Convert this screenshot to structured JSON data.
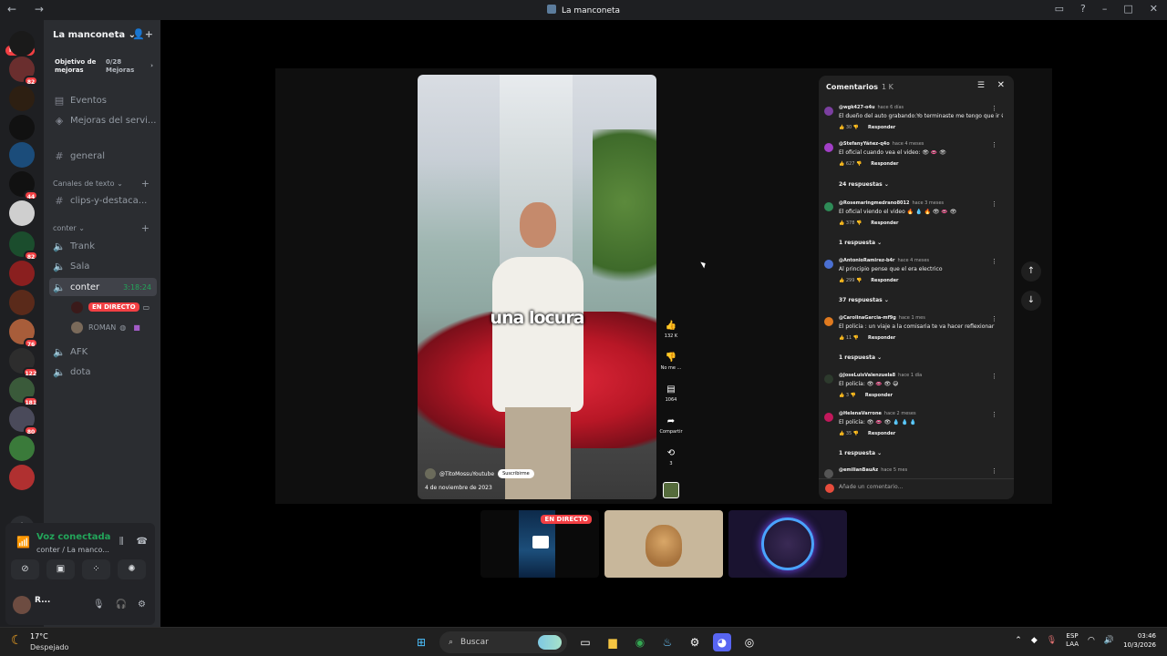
{
  "window": {
    "title": "La manconeta",
    "nav": "← →"
  },
  "titlebar_icons": [
    "inbox-icon",
    "help-icon",
    "minimize-icon",
    "maximize-icon",
    "close-icon"
  ],
  "guilds": {
    "nuevo_badge": "NUEVO",
    "items": [
      {
        "badge": "",
        "color": "#1a1a1a"
      },
      {
        "badge": "82",
        "color": "#6a2e2e"
      },
      {
        "badge": "",
        "color": "#2d1f12"
      },
      {
        "badge": "",
        "color": "#111111"
      },
      {
        "badge": "",
        "color": "#1b4c7a"
      },
      {
        "badge": "44",
        "color": "#111111"
      },
      {
        "badge": "",
        "color": "#cfcfcf"
      },
      {
        "badge": "82",
        "color": "#1b4d2d"
      },
      {
        "badge": "",
        "color": "#8a1f1f"
      },
      {
        "badge": "",
        "color": "#5a2a1a"
      },
      {
        "badge": "76",
        "color": "#a85d3a"
      },
      {
        "badge": "122",
        "color": "#2d2d2d"
      },
      {
        "badge": "181",
        "color": "#3a5a3a"
      },
      {
        "badge": "80",
        "color": "#4a4a5a"
      },
      {
        "badge": "",
        "color": "#3a7a3a"
      },
      {
        "badge": "",
        "color": "#b03030"
      }
    ]
  },
  "server": {
    "name": "La manconeta ⌄",
    "boost_label": "Objetivo de mejoras",
    "boost_count": "0/28 Mejoras",
    "boost_chevron": "›"
  },
  "channels": {
    "eventos": "Eventos",
    "mejoras": "Mejoras del servi...",
    "general": "general",
    "cat_text": "Canales de texto ⌄",
    "clips": "clips-y-destaca...",
    "cat_conter": "conter ⌄",
    "trank": "Trank",
    "sala": "Sala",
    "conter": "conter",
    "conter_time": "3:18:24",
    "live_label": "EN DIRECTO",
    "user_roman": "ROMAN",
    "afk": "AFK",
    "dota": "dota"
  },
  "voice_panel": {
    "title": "Voz conectada",
    "subtitle": "conter / La manco...",
    "user": "R..."
  },
  "video": {
    "caption": "una locura",
    "channel": "@TitoMossuYoutube",
    "subscribe": "Suscribirme",
    "date": "4 de noviembre de 2023",
    "likes": "132 K",
    "dislike_label": "No me ...",
    "comments_count": "1064",
    "share_label": "Compartir",
    "remix_count": "3"
  },
  "comments": {
    "title": "Comentarios",
    "count": "1 K",
    "add_placeholder": "Añade un comentario...",
    "reply_label": "Responder",
    "items": [
      {
        "author": "@wgk427-o4u",
        "time": "hace 6 días",
        "text": "El dueño del auto grabando:Yo terminaste me tengo que ir 😅",
        "likes": "30",
        "color": "#7b3fa0"
      },
      {
        "author": "@StefanyYáñez-q4o",
        "time": "hace 4 meses",
        "text": "El oficial cuando vea el video: 👁 👄 👁",
        "likes": "627",
        "color": "#a23fc7"
      },
      {
        "author": "@Rosemaringmedrano8012",
        "time": "hace 3 meses",
        "text": "El oficial viendo el video 🔥 💧 🔥 👁 👄 👁",
        "likes": "378",
        "color": "#2e8b57"
      },
      {
        "author": "@AntonioRamirez-b4r",
        "time": "hace 4 meses",
        "text": "Al principio pense que el era electrico",
        "likes": "299",
        "color": "#4a6fd1"
      },
      {
        "author": "@CarolinaGarcia-mf9g",
        "time": "hace 1 mes",
        "text": "El policia : un viaje a la comisaria te va hacer reflexionar",
        "likes": "11",
        "color": "#e07a1f"
      },
      {
        "author": "@JoseLuisValenzuela8",
        "time": "hace 1 día",
        "text": "El policía: 👁 👄 👁 😅",
        "likes": "3",
        "color": "#2d3a2d"
      },
      {
        "author": "@HelenaVarrone",
        "time": "hace 2 meses",
        "text": "El policía: 👁 👄 👁 💧 💧 💧",
        "likes": "35",
        "color": "#c2185b"
      },
      {
        "author": "@emilianBauAz",
        "time": "hace 5 mes",
        "text": "",
        "likes": "",
        "color": "#555555"
      }
    ],
    "replies": [
      "24 respuestas ⌄",
      "1 respuesta ⌄",
      "37 respuestas ⌄",
      "1 respuesta ⌄",
      "1 respuesta ⌄"
    ]
  },
  "stream_tiles": {
    "live_label": "EN DIRECTO"
  },
  "taskbar": {
    "temp": "17°C",
    "weather": "Despejado",
    "search": "Buscar",
    "lang1": "ESP",
    "lang2": "LAA",
    "time": "03:46",
    "date": "10/3/2026"
  }
}
